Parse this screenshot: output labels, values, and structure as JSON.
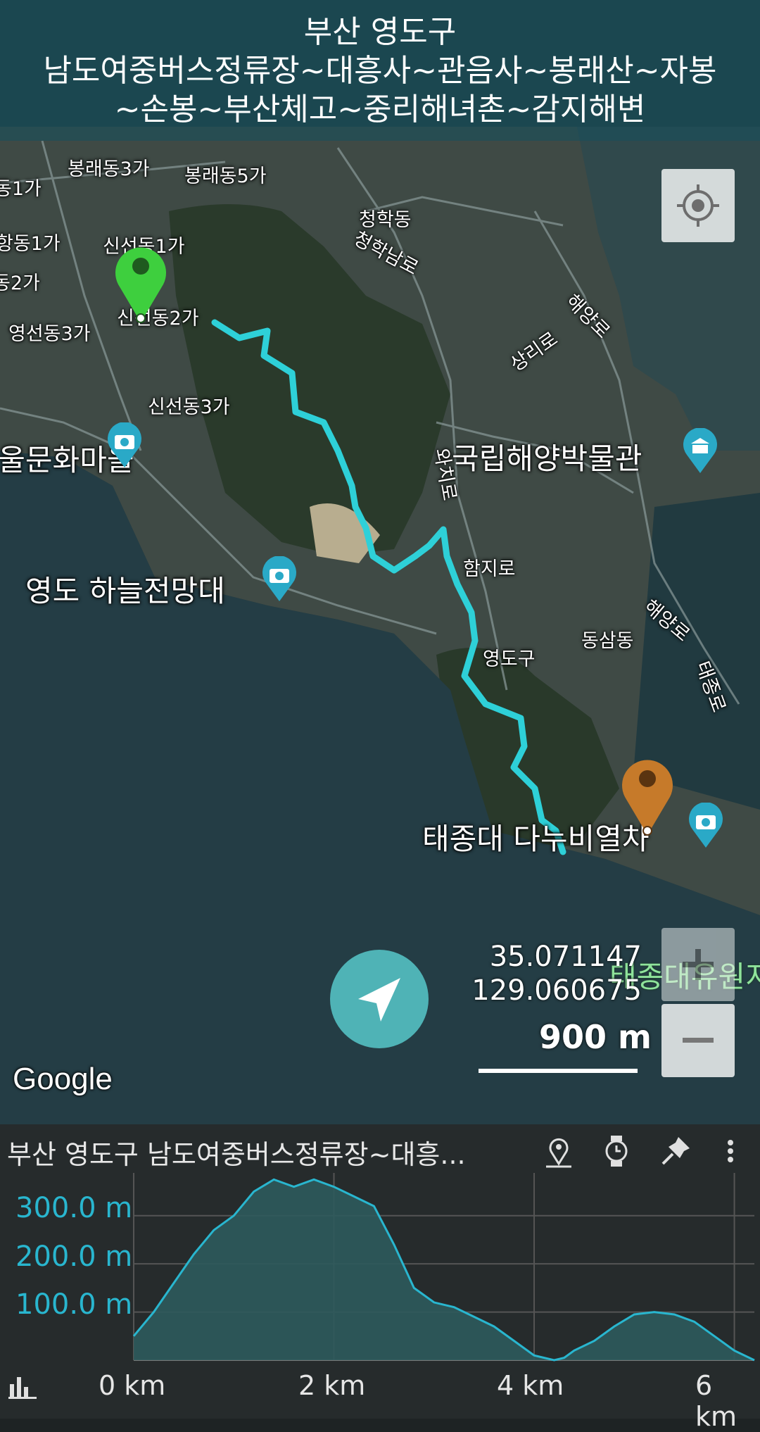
{
  "title": {
    "line1": "부산 영도구",
    "line2": "남도여중버스정류장~대흥사~관음사~봉래산~자봉",
    "line3": "~손봉~부산체고~중리해녀촌~감지해변"
  },
  "map_labels": {
    "bongnae3": "봉래동3가",
    "bongnae5": "봉래동5가",
    "dong1": "동1가",
    "hang1": "항동1가",
    "sinseon1": "신선동1가",
    "dong2": "동2가",
    "sinseon2": "신선동2가",
    "yeongseon3": "영선동3가",
    "sinseon3": "신선동3가",
    "cheonghak": "청학동",
    "cheonghaknamro": "청학남로",
    "haeyangro1": "해양로",
    "sangriro": "상리로",
    "hwamaeul": "흰여울문화마을",
    "museum": "국립해양박물관",
    "wajiro": "와치로",
    "observatory": "영도 하늘전망대",
    "hamjiro": "함지로",
    "haeyangro2": "해양로",
    "dongsam": "동삼동",
    "yeongdogu": "영도구",
    "taejongro": "태종로",
    "danubi": "태종대 다누비열차",
    "taejongdae_park": "태종대유원지"
  },
  "coords": {
    "lat": "35.071147",
    "lng": "129.060675"
  },
  "scale": "900 m",
  "google": "Google",
  "panel": {
    "title": "부산 영도구 남도여중버스정류장~대흥...",
    "y_labels": [
      "300.0 m",
      "200.0 m",
      "100.0 m"
    ],
    "x_labels": [
      "0 km",
      "2 km",
      "4 km",
      "6 km"
    ]
  },
  "icons": {
    "locate": "crosshair-icon",
    "zoom_in": "plus-icon",
    "zoom_out": "minus-icon",
    "navigate": "navigation-arrow-icon",
    "start": "start-pin-icon",
    "end": "end-pin-icon",
    "panel": [
      "map-marker-icon",
      "watch-icon",
      "pin-icon",
      "more-icon"
    ],
    "chart": "bar-chart-icon"
  },
  "colors": {
    "route": "#2ed0d8",
    "start_pin": "#3ecf3e",
    "end_pin": "#c67a2a",
    "accent": "#29b6cf"
  },
  "chart_data": {
    "type": "area",
    "x_unit": "km",
    "y_unit": "m",
    "xlim": [
      0,
      6.2
    ],
    "ylim": [
      0,
      380
    ],
    "x": [
      0,
      0.2,
      0.4,
      0.6,
      0.8,
      1.0,
      1.2,
      1.4,
      1.6,
      1.8,
      2.0,
      2.2,
      2.4,
      2.6,
      2.8,
      3.0,
      3.2,
      3.4,
      3.6,
      3.8,
      4.0,
      4.2,
      4.3,
      4.4,
      4.6,
      4.8,
      5.0,
      5.2,
      5.4,
      5.6,
      5.8,
      6.0,
      6.2
    ],
    "y": [
      50,
      100,
      160,
      220,
      270,
      300,
      350,
      375,
      360,
      375,
      360,
      340,
      320,
      240,
      150,
      120,
      110,
      90,
      70,
      40,
      10,
      0,
      5,
      20,
      40,
      70,
      95,
      100,
      95,
      80,
      50,
      20,
      0
    ]
  }
}
